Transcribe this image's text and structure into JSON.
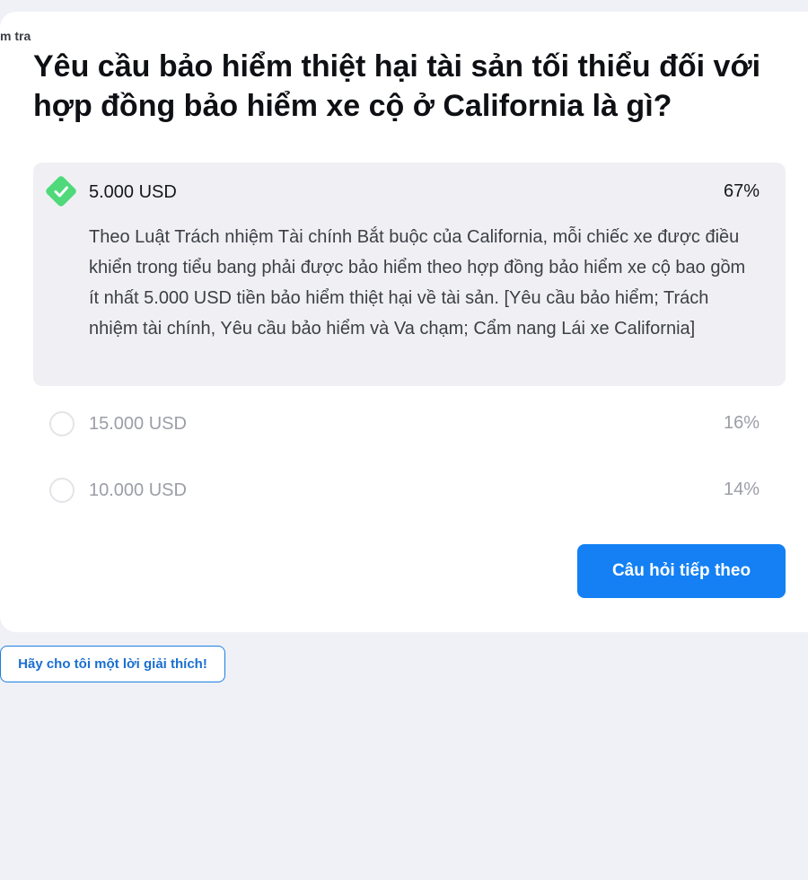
{
  "header": {
    "fragment_text": "m tra"
  },
  "question": {
    "text": "Yêu cầu bảo hiểm thiệt hại tài sản tối thiểu đối với hợp đồng bảo hiểm xe cộ ở California là gì?"
  },
  "options": [
    {
      "label": "5.000 USD",
      "percent": "67%",
      "correct": true,
      "explanation": "Theo Luật Trách nhiệm Tài chính Bắt buộc của California, mỗi chiếc xe được điều khiển trong tiểu bang phải được bảo hiểm theo hợp đồng bảo hiểm xe cộ bao gồm ít nhất 5.000 USD tiền bảo hiểm thiệt hại về tài sản. [Yêu cầu bảo hiểm; Trách nhiệm tài chính, Yêu cầu bảo hiểm và Va chạm; Cẩm nang Lái xe California]"
    },
    {
      "label": "15.000 USD",
      "percent": "16%",
      "correct": false
    },
    {
      "label": "10.000 USD",
      "percent": "14%",
      "correct": false
    }
  ],
  "buttons": {
    "next_label": "Câu hỏi tiếp theo",
    "explain_label": "Hãy cho tôi một lời giải thích!"
  },
  "colors": {
    "accent": "#1480f4",
    "correct": "#4fd97a",
    "background": "#f0f1f6"
  },
  "icons": {
    "correct_icon": "check-diamond-icon",
    "radio_icon": "radio-empty-icon"
  }
}
